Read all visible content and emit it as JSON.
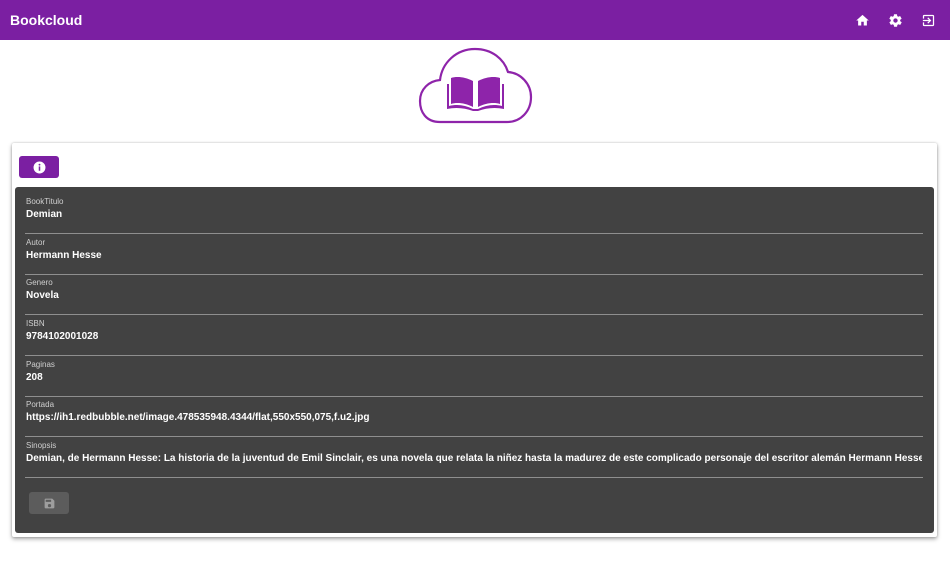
{
  "app": {
    "title": "Bookcloud"
  },
  "header": {
    "icons": {
      "home": "home-icon",
      "settings": "gear-icon",
      "logout": "exit-icon"
    }
  },
  "logo": {
    "icon": "cloud-book-icon",
    "color": "#8e24aa"
  },
  "toolbar": {
    "info_icon": "info-icon"
  },
  "form": {
    "fields": [
      {
        "label": "BookTitulo",
        "value": "Demian"
      },
      {
        "label": "Autor",
        "value": "Hermann Hesse"
      },
      {
        "label": "Genero",
        "value": "Novela"
      },
      {
        "label": "ISBN",
        "value": "9784102001028"
      },
      {
        "label": "Paginas",
        "value": "208"
      },
      {
        "label": "Portada",
        "value": "https://ih1.redbubble.net/image.478535948.4344/flat,550x550,075,f.u2.jpg"
      },
      {
        "label": "Sinopsis",
        "value": "Demian, de Hermann Hesse: La historia de la juventud de Emil Sinclair, es una novela que relata la niñez hasta la madurez de este complicado personaje del escritor alemán Hermann Hesse."
      }
    ],
    "save_icon": "save-icon",
    "save_disabled": true
  },
  "colors": {
    "primary": "#7b1fa2",
    "panel": "#424242",
    "disabled": "#5c5c5c"
  }
}
